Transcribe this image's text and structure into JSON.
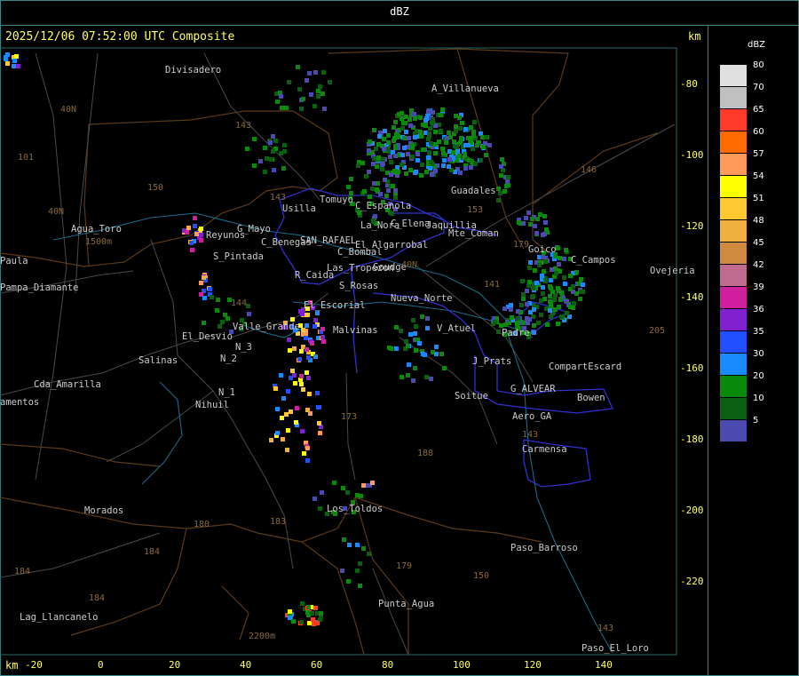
{
  "header": {
    "title": "dBZ"
  },
  "map": {
    "timestamp": "2025/12/06 07:52:00 UTC Composite",
    "unit_top": "km",
    "unit_bottom": "km",
    "y_ticks": [
      "-80",
      "-100",
      "-120",
      "-140",
      "-160",
      "-180",
      "-200",
      "-220"
    ],
    "x_ticks": [
      "-20",
      "0",
      "20",
      "40",
      "60",
      "80",
      "100",
      "120",
      "140"
    ],
    "places": [
      {
        "name": "Divisadero",
        "c": "#ccc"
      },
      {
        "name": "A_Villanueva",
        "c": "#ccc"
      },
      {
        "name": "Guadales",
        "c": "#ccc"
      },
      {
        "name": "Tomuyo",
        "c": "#ccc"
      },
      {
        "name": "Usilla",
        "c": "#ccc"
      },
      {
        "name": "C_Espanola",
        "c": "#ccc"
      },
      {
        "name": "La_Nora",
        "c": "#ccc"
      },
      {
        "name": "C_Elena",
        "c": "#ccc"
      },
      {
        "name": "Agua_Toro",
        "c": "#ccc"
      },
      {
        "name": "Reyunos",
        "c": "#ccc"
      },
      {
        "name": "G_Mayo",
        "c": "#ccc"
      },
      {
        "name": "C_Benegas",
        "c": "#ccc"
      },
      {
        "name": "SAN_RAFAEL",
        "c": "#ccc"
      },
      {
        "name": "El_Algarrobal",
        "c": "#ccc"
      },
      {
        "name": "Jaquillia",
        "c": "#ccc"
      },
      {
        "name": "Mte_Coman",
        "c": "#ccc"
      },
      {
        "name": "Goico",
        "c": "#ccc"
      },
      {
        "name": "C_Campos",
        "c": "#ccc"
      },
      {
        "name": "Ovejeria",
        "c": "#ccc"
      },
      {
        "name": "Paula",
        "c": "#ccc"
      },
      {
        "name": "S_Pintada",
        "c": "#ccc"
      },
      {
        "name": "C_Bombal",
        "c": "#ccc"
      },
      {
        "name": "Las_Tropezon",
        "c": "#ccc"
      },
      {
        "name": "Goudge",
        "c": "#ccc"
      },
      {
        "name": "Pampa_Diamante",
        "c": "#ccc"
      },
      {
        "name": "R_Caida",
        "c": "#ccc"
      },
      {
        "name": "S_Rosas",
        "c": "#ccc"
      },
      {
        "name": "Nueva_Norte",
        "c": "#ccc"
      },
      {
        "name": "El_Escorial",
        "c": "#ccc"
      },
      {
        "name": "Valle_Grande",
        "c": "#ccc"
      },
      {
        "name": "Malvinas",
        "c": "#ccc"
      },
      {
        "name": "V_Atuel",
        "c": "#ccc"
      },
      {
        "name": "Padre",
        "c": "#ccc"
      },
      {
        "name": "El_Desvio",
        "c": "#ccc"
      },
      {
        "name": "Salinas",
        "c": "#ccc"
      },
      {
        "name": "N_2",
        "c": "#ccc"
      },
      {
        "name": "N_3",
        "c": "#ccc"
      },
      {
        "name": "J_Prats",
        "c": "#ccc"
      },
      {
        "name": "CompartEscard",
        "c": "#ccc"
      },
      {
        "name": "Cda_Amarilla",
        "c": "#ccc"
      },
      {
        "name": "N_1",
        "c": "#ccc"
      },
      {
        "name": "Soitue",
        "c": "#ccc"
      },
      {
        "name": "G_ALVEAR",
        "c": "#ccc"
      },
      {
        "name": "Bowen",
        "c": "#ccc"
      },
      {
        "name": "amentos",
        "c": "#ccc"
      },
      {
        "name": "Nihuil",
        "c": "#ccc"
      },
      {
        "name": "Aero_GA",
        "c": "#ccc"
      },
      {
        "name": "Carmensa",
        "c": "#ccc"
      },
      {
        "name": "Morados",
        "c": "#ccc"
      },
      {
        "name": "Los_Toldos",
        "c": "#ccc"
      },
      {
        "name": "Paso_Barroso",
        "c": "#ccc"
      },
      {
        "name": "Punta_Agua",
        "c": "#ccc"
      },
      {
        "name": "Lag_Llancanelo",
        "c": "#ccc"
      },
      {
        "name": "Paso_El_Loro",
        "c": "#ccc"
      }
    ],
    "route_numbers": [
      "101",
      "40N",
      "143",
      "150",
      "146",
      "153",
      "40N",
      "144",
      "141",
      "173",
      "188",
      "205",
      "180",
      "184",
      "184",
      "179",
      "184",
      "183",
      "150",
      "143",
      "143",
      "179",
      "40N",
      "143"
    ],
    "elev_labels": [
      "1500m",
      "2200m"
    ]
  },
  "legend": {
    "title": "dBZ",
    "entries": [
      {
        "label": "80",
        "color": "#e0e0e0"
      },
      {
        "label": "70",
        "color": "#c0c0c0"
      },
      {
        "label": "65",
        "color": "#ff3a2a"
      },
      {
        "label": "60",
        "color": "#ff6a00"
      },
      {
        "label": "57",
        "color": "#ff9a5a"
      },
      {
        "label": "54",
        "color": "#ffff00"
      },
      {
        "label": "51",
        "color": "#ffc830"
      },
      {
        "label": "48",
        "color": "#f0b040"
      },
      {
        "label": "45",
        "color": "#d08a40"
      },
      {
        "label": "42",
        "color": "#c06a90"
      },
      {
        "label": "39",
        "color": "#d020a0"
      },
      {
        "label": "36",
        "color": "#8020d0"
      },
      {
        "label": "35",
        "color": "#2050ff"
      },
      {
        "label": "30",
        "color": "#1a8aff"
      },
      {
        "label": "20",
        "color": "#0a8a0a"
      },
      {
        "label": "10",
        "color": "#0a6010"
      },
      {
        "label": "5",
        "color": "#4a4ab0"
      }
    ]
  }
}
